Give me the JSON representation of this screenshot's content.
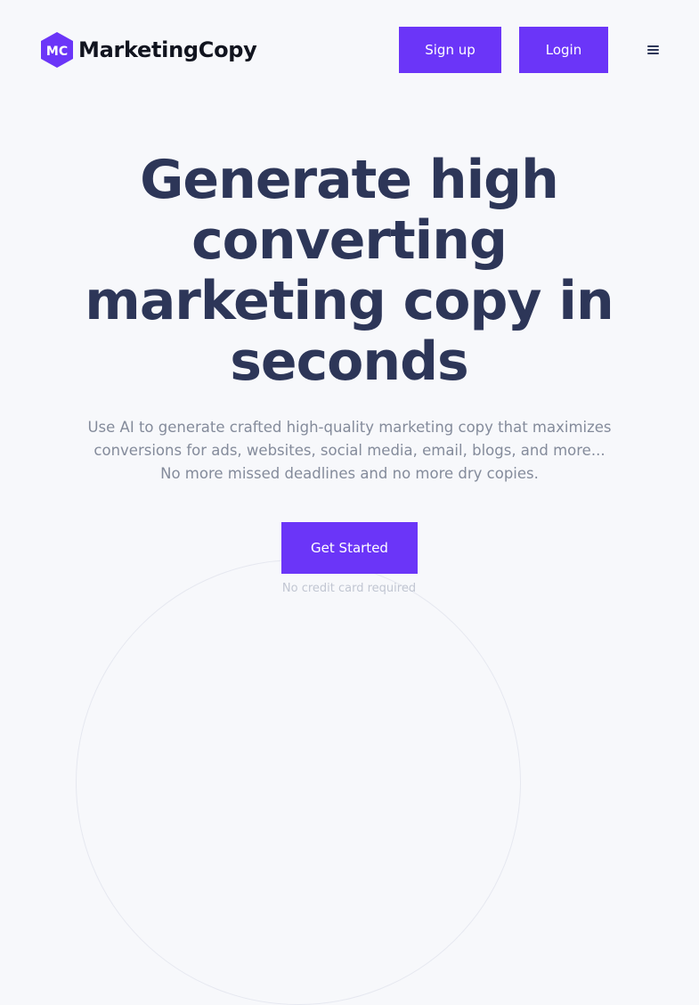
{
  "header": {
    "logo_monogram": "MC",
    "logo_text": "MarketingCopy",
    "signup_label": "Sign up",
    "login_label": "Login",
    "menu_icon": "hamburger-menu-icon"
  },
  "hero": {
    "title": "Generate high converting marketing copy in seconds",
    "subtitle_lines": [
      "Use AI to generate crafted high-quality marketing copy that maximizes",
      "conversions for ads, websites, social media, email, blogs, and more...",
      "No more missed deadlines and no more dry copies."
    ],
    "cta_label": "Get Started",
    "cta_note": "No credit card required"
  },
  "colors": {
    "accent": "#6b35f8",
    "heading": "#2d3658",
    "body_text": "#848b9b",
    "background": "#f7f8fb"
  }
}
